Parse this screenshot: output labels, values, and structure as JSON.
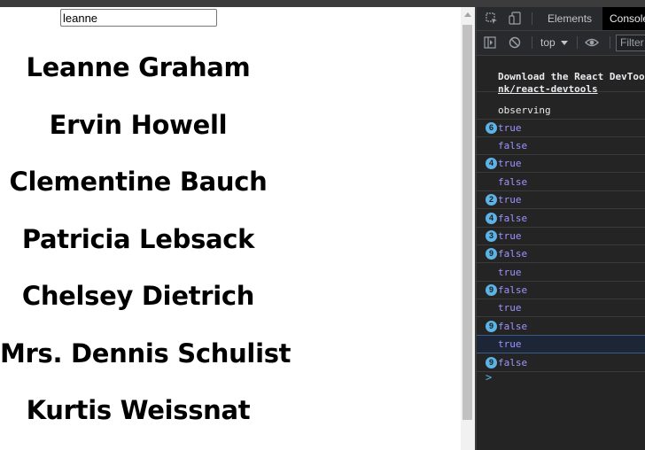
{
  "search": {
    "value": "leanne"
  },
  "users": [
    "Leanne Graham",
    "Ervin Howell",
    "Clementine Bauch",
    "Patricia Lebsack",
    "Chelsey Dietrich",
    "Mrs. Dennis Schulist",
    "Kurtis Weissnat"
  ],
  "devtools": {
    "tabs": [
      "Elements",
      "Console"
    ],
    "active_tab": "Console",
    "context": "top",
    "filter_placeholder": "Filter",
    "devtools_message_line1": "Download the React DevTools",
    "devtools_message_line2": "nk/react-devtools",
    "messages": [
      {
        "count": "",
        "text": "observing",
        "kind": "plain"
      },
      {
        "count": "6",
        "text": "true",
        "kind": "bool"
      },
      {
        "count": "",
        "text": "false",
        "kind": "bool"
      },
      {
        "count": "4",
        "text": "true",
        "kind": "bool"
      },
      {
        "count": "",
        "text": "false",
        "kind": "bool"
      },
      {
        "count": "2",
        "text": "true",
        "kind": "bool"
      },
      {
        "count": "4",
        "text": "false",
        "kind": "bool"
      },
      {
        "count": "3",
        "text": "true",
        "kind": "bool"
      },
      {
        "count": "9",
        "text": "false",
        "kind": "bool"
      },
      {
        "count": "",
        "text": "true",
        "kind": "bool"
      },
      {
        "count": "9",
        "text": "false",
        "kind": "bool"
      },
      {
        "count": "",
        "text": "true",
        "kind": "bool"
      },
      {
        "count": "9",
        "text": "false",
        "kind": "bool"
      },
      {
        "count": "",
        "text": "true",
        "kind": "bool"
      },
      {
        "count": "9",
        "text": "false",
        "kind": "bool"
      }
    ],
    "prompt_symbol": ">"
  }
}
